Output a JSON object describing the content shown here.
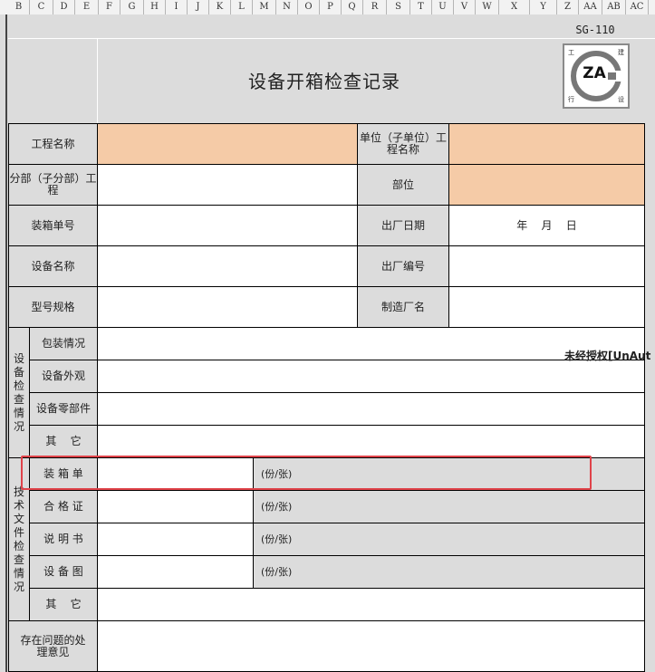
{
  "columns": [
    "B",
    "C",
    "D",
    "E",
    "F",
    "G",
    "H",
    "I",
    "J",
    "K",
    "L",
    "M",
    "N",
    "O",
    "P",
    "Q",
    "R",
    "S",
    "T",
    "U",
    "V",
    "W",
    "X",
    "Y",
    "Z",
    "AA",
    "AB",
    "AC"
  ],
  "form": {
    "code": "SG-110",
    "title": "设备开箱检查记录",
    "logo_text": "ZA",
    "logo_corners": [
      "工",
      "建",
      "行",
      "设"
    ],
    "project_name_label": "工程名称",
    "unit_project_label": "单位（子单位）工程名称",
    "sub_project_label": "分部（子分部）工程",
    "position_label": "部位",
    "packing_no_label": "装箱单号",
    "factory_date_label": "出厂日期",
    "factory_date_value": "年    月    日",
    "device_name_label": "设备名称",
    "factory_no_label": "出厂编号",
    "model_label": "型号规格",
    "manufacturer_label": "制造厂名",
    "device_check_group": "设备检查情况",
    "device_check_items": [
      "包装情况",
      "设备外观",
      "设备零部件",
      "其    它"
    ],
    "doc_check_group": "技术文件检查情况",
    "doc_check_items": [
      "装 箱 单",
      "合 格 证",
      "说 明 书",
      "设 备 图",
      "其    它"
    ],
    "unit_text": "(份/张)",
    "issue_label": "存在问题的处理意见"
  },
  "watermark": "未经授权[UnAut"
}
